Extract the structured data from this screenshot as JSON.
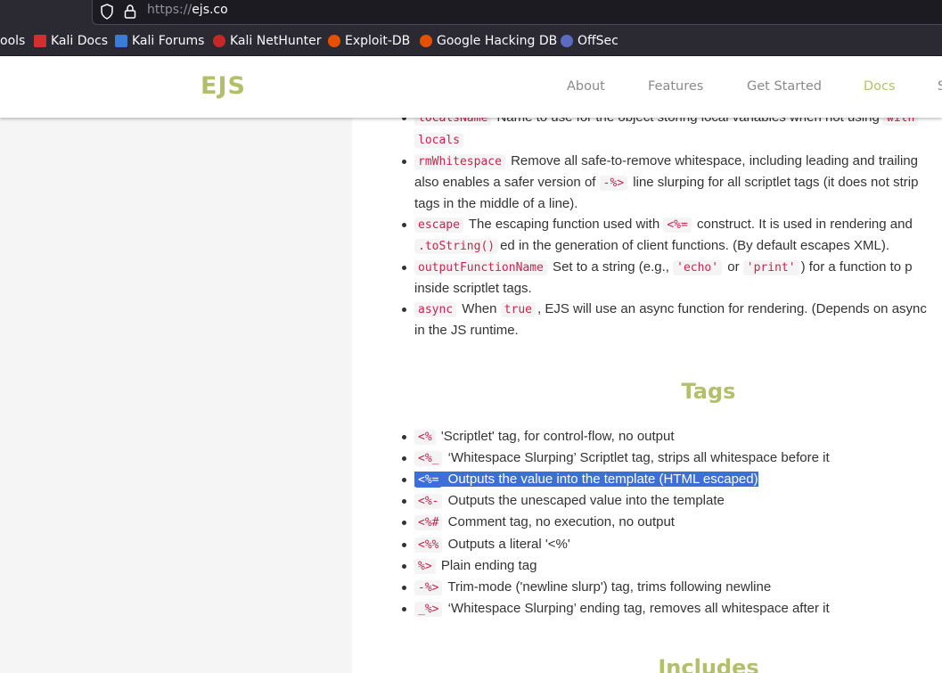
{
  "browser": {
    "url_scheme": "https://",
    "url_host": "ejs.co",
    "bookmarks": [
      {
        "label": "ools",
        "color": ""
      },
      {
        "label": "Kali Docs",
        "color": "#d32f2f"
      },
      {
        "label": "Kali Forums",
        "color": "#3a7bd5"
      },
      {
        "label": "Kali NetHunter",
        "color": "#c62828"
      },
      {
        "label": "Exploit-DB",
        "color": "#e65100"
      },
      {
        "label": "Google Hacking DB",
        "color": "#e65100"
      },
      {
        "label": "OffSec",
        "color": "#5c6bc0"
      }
    ]
  },
  "site": {
    "logo": "EJS",
    "nav": [
      "About",
      "Features",
      "Get Started",
      "Docs",
      "S"
    ],
    "active_nav": "Docs"
  },
  "options": {
    "items": [
      {
        "parts": [
          {
            "code": "localsName"
          },
          {
            "text": " Name to use for the object storing local variables when not using "
          },
          {
            "code": "with"
          }
        ]
      },
      {
        "parts": [
          {
            "code": "locals"
          }
        ],
        "cont": true
      },
      {
        "parts": [
          {
            "code": "rmWhitespace"
          },
          {
            "text": " Remove all safe-to-remove whitespace, including leading and trailing"
          }
        ]
      },
      {
        "parts": [
          {
            "text": "also enables a safer version of "
          },
          {
            "code": "-%>"
          },
          {
            "text": " line slurping for all scriptlet tags (it does not strip"
          }
        ],
        "cont": true
      },
      {
        "parts": [
          {
            "text": "tags in the middle of a line)."
          }
        ],
        "cont": true
      },
      {
        "parts": [
          {
            "code": "escape"
          },
          {
            "text": " The escaping function used with "
          },
          {
            "code": "<%="
          },
          {
            "text": " construct. It is used in rendering and"
          }
        ]
      },
      {
        "parts": [
          {
            "code": ".toString()"
          },
          {
            "text": "ed in the generation of client functions. (By default escapes XML)."
          }
        ],
        "cont": true
      },
      {
        "parts": [
          {
            "code": "outputFunctionName"
          },
          {
            "text": " Set to a string (e.g., "
          },
          {
            "code": "'echo'"
          },
          {
            "text": " or "
          },
          {
            "code": "'print'"
          },
          {
            "text": ") for a function to p"
          }
        ]
      },
      {
        "parts": [
          {
            "text": "inside scriptlet tags."
          }
        ],
        "cont": true
      },
      {
        "parts": [
          {
            "code": "async"
          },
          {
            "text": " When "
          },
          {
            "code": "true"
          },
          {
            "text": ", EJS will use an async function for rendering. (Depends on async"
          }
        ]
      },
      {
        "parts": [
          {
            "text": "in the JS runtime."
          }
        ],
        "cont": true
      }
    ]
  },
  "tags": {
    "title": "Tags",
    "items": [
      {
        "code": "<%",
        "text": " 'Scriptlet' tag, for control-flow, no output"
      },
      {
        "code": "<%_",
        "text": " ‘Whitespace Slurping’ Scriptlet tag, strips all whitespace before it"
      },
      {
        "code": "<%=",
        "text": " Outputs the value into the template (HTML escaped)",
        "highlighted": true
      },
      {
        "code": "<%-",
        "text": " Outputs the unescaped value into the template"
      },
      {
        "code": "<%#",
        "text": " Comment tag, no execution, no output"
      },
      {
        "code": "<%%",
        "text": " Outputs a literal '<%'"
      },
      {
        "code": "%>",
        "text": " Plain ending tag"
      },
      {
        "code": "-%>",
        "text": " Trim-mode ('newline slurp') tag, trims following newline"
      },
      {
        "code": "_%>",
        "text": " ‘Whitespace Slurping’ ending tag, removes all whitespace after it"
      }
    ]
  },
  "includes": {
    "title": "Includes"
  }
}
